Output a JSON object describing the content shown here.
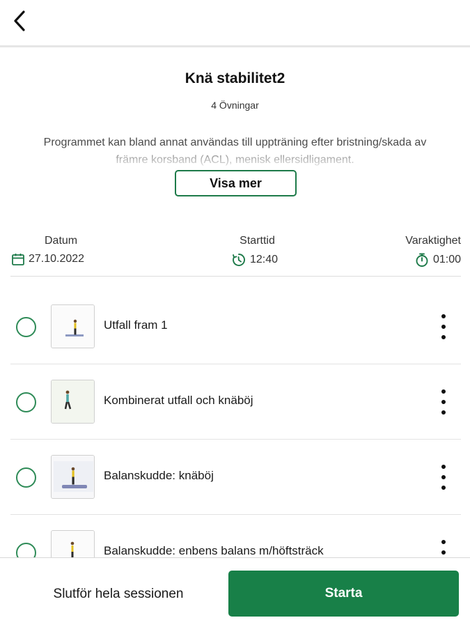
{
  "header": {
    "back_icon": "chevron-left-icon"
  },
  "program": {
    "title": "Knä stabilitet2",
    "subtitle": "4 Övningar",
    "description": "Programmet kan bland annat användas till uppträning efter bristning/skada av främre korsband (ACL), menisk ellersidligament.",
    "show_more_label": "Visa mer"
  },
  "info": {
    "date": {
      "label": "Datum",
      "value": "27.10.2022",
      "icon": "calendar-icon"
    },
    "start_time": {
      "label": "Starttid",
      "value": "12:40",
      "icon": "clock-icon"
    },
    "duration": {
      "label": "Varaktighet",
      "value": "01:00",
      "icon": "stopwatch-icon"
    }
  },
  "exercises": [
    {
      "name": "Utfall fram 1"
    },
    {
      "name": "Kombinerat utfall och knäböj"
    },
    {
      "name": "Balanskudde: knäböj"
    },
    {
      "name": "Balanskudde: enbens balans m/höftsträck"
    }
  ],
  "footer": {
    "finish_label": "Slutför hela sessionen",
    "start_label": "Starta"
  },
  "colors": {
    "accent": "#188048",
    "outline": "#2e8b57"
  }
}
